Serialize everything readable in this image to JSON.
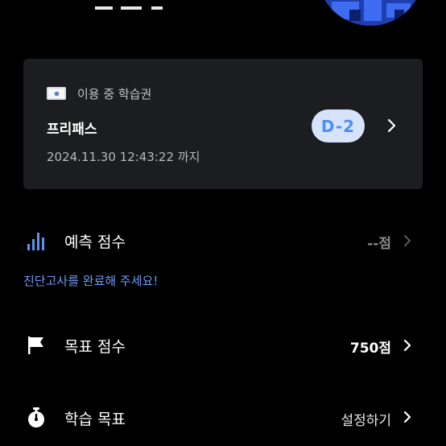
{
  "pass_card": {
    "label": "이용 중 학습권",
    "name": "프리패스",
    "dday": "D-2",
    "expiry": "2024.11.30 12:43:22 까지"
  },
  "prediction": {
    "title": "예측 점수",
    "value": "--점",
    "hint": "진단고사를 완료해 주세요!"
  },
  "goal_score": {
    "title": "목표 점수",
    "value": "750점"
  },
  "study_goal": {
    "title": "학습 목표",
    "value": "설정하기"
  },
  "colors": {
    "background": "#000000",
    "card": "#1c1d20",
    "accent": "#4f8ef0",
    "hint": "#6f9cf2",
    "muted": "#8a8a8a"
  },
  "icons": [
    "ticket-icon",
    "bar-chart-icon",
    "flag-icon",
    "timer-icon",
    "chevron-right-icon"
  ]
}
